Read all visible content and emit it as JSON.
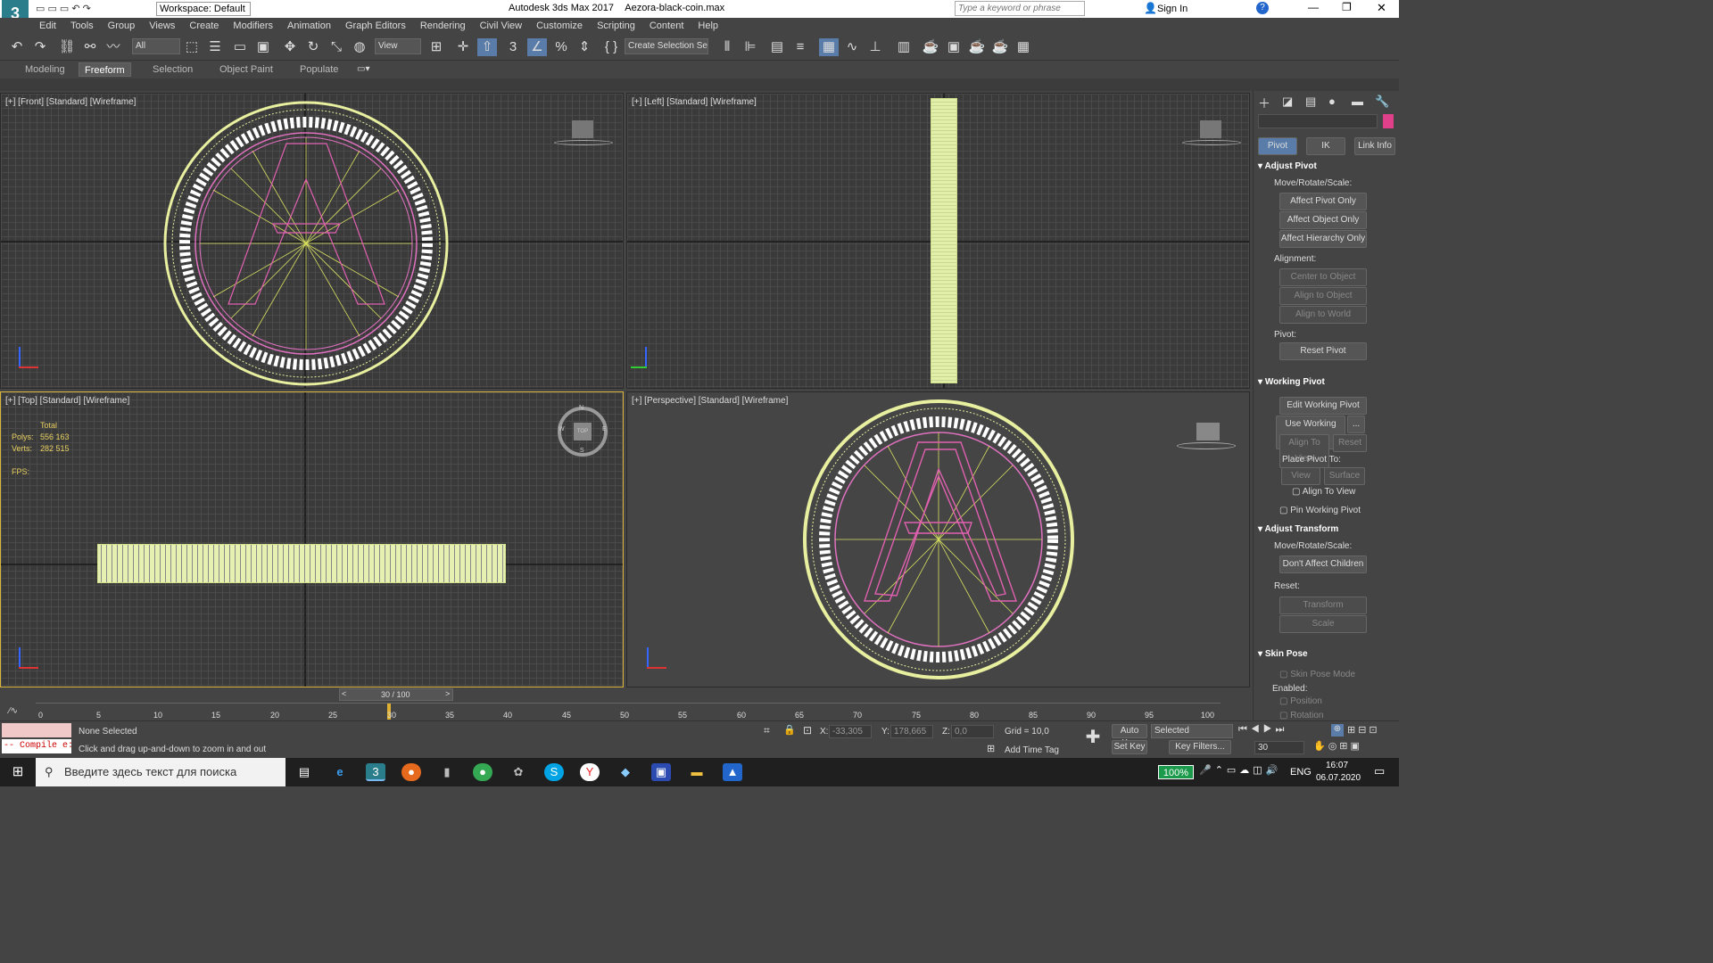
{
  "app": {
    "title": "Autodesk 3ds Max 2017",
    "file": "Aezora-black-coin.max",
    "workspace": "Workspace: Default",
    "search_placeholder": "Type a keyword or phrase",
    "sign_in": "Sign In"
  },
  "menu": [
    "Edit",
    "Tools",
    "Group",
    "Views",
    "Create",
    "Modifiers",
    "Animation",
    "Graph Editors",
    "Rendering",
    "Civil View",
    "Customize",
    "Scripting",
    "Content",
    "Help"
  ],
  "toolbar": {
    "filter": "All",
    "view": "View",
    "selection_set": "Create Selection Se"
  },
  "ribbon": {
    "tabs": [
      "Modeling",
      "Freeform",
      "Selection",
      "Object Paint",
      "Populate"
    ]
  },
  "viewports": {
    "front": "[+] [Front] [Standard] [Wireframe]",
    "left": "[+] [Left] [Standard] [Wireframe]",
    "top": "[+] [Top] [Standard] [Wireframe]",
    "persp": "[+] [Perspective] [Standard] [Wireframe]"
  },
  "stats": {
    "total": "Total",
    "polys_label": "Polys:",
    "polys": "556 163",
    "verts_label": "Verts:",
    "verts": "282 515",
    "fps": "FPS:"
  },
  "viewcube": {
    "top": "TOP",
    "n": "N",
    "s": "S",
    "w": "W",
    "e": "E"
  },
  "cmd": {
    "tabs": [
      "Pivot",
      "IK",
      "Link Info"
    ],
    "adjust_pivot": "Adjust Pivot",
    "move": "Move/Rotate/Scale:",
    "affect_pivot": "Affect Pivot Only",
    "affect_object": "Affect Object Only",
    "affect_hier": "Affect Hierarchy Only",
    "alignment": "Alignment:",
    "center": "Center to Object",
    "align_obj": "Align to Object",
    "align_world": "Align to World",
    "pivot": "Pivot:",
    "reset_pivot": "Reset Pivot",
    "working_pivot": "Working Pivot",
    "edit_wp": "Edit Working Pivot",
    "use_wp": "Use Working Pivot",
    "dots": "...",
    "align_view": "Align To View",
    "reset": "Reset",
    "place_to": "Place Pivot To:",
    "view": "View",
    "surface": "Surface",
    "align_to_view": "Align To View",
    "pin_wp": "Pin Working Pivot",
    "adjust_transform": "Adjust Transform",
    "move2": "Move/Rotate/Scale:",
    "dont_affect": "Don't Affect Children",
    "reset2": "Reset:",
    "transform": "Transform",
    "scale": "Scale",
    "skin_pose": "Skin Pose",
    "skin_mode": "Skin Pose Mode",
    "enabled": "Enabled:",
    "position": "Position",
    "rotation": "Rotation"
  },
  "timeline": {
    "frame": "30 / 100",
    "ticks": [
      "0",
      "5",
      "10",
      "15",
      "20",
      "25",
      "30",
      "35",
      "40",
      "45",
      "50",
      "55",
      "60",
      "65",
      "70",
      "75",
      "80",
      "85",
      "90",
      "95",
      "100"
    ]
  },
  "status": {
    "none_selected": "None Selected",
    "hint": "Click and drag up-and-down to zoom in and out",
    "compile": "-- Compile e:",
    "x_label": "X:",
    "x": "-33,305",
    "y_label": "Y:",
    "y": "178,665",
    "z_label": "Z:",
    "z": "0,0",
    "grid": "Grid = 10,0",
    "add_time_tag": "Add Time Tag",
    "auto_key": "Auto Key",
    "set_key": "Set Key",
    "selected": "Selected",
    "key_filters": "Key Filters...",
    "frame": "30"
  },
  "taskbar": {
    "search": "Введите здесь текст для поиска",
    "battery": "100%",
    "lang": "ENG",
    "time": "16:07",
    "date": "06.07.2020"
  }
}
